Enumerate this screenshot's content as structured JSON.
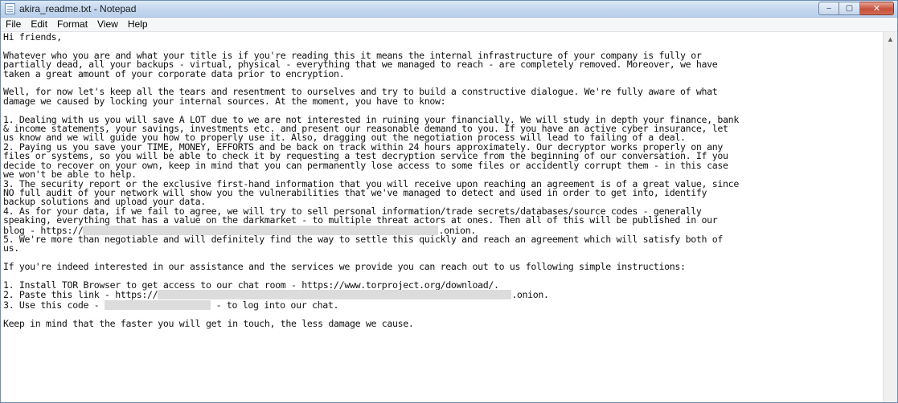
{
  "window": {
    "title": "akira_readme.txt - Notepad",
    "controls": {
      "minimize": "‒",
      "maximize": "▢",
      "close": "✕"
    }
  },
  "menu": [
    "File",
    "Edit",
    "Format",
    "View",
    "Help"
  ],
  "document": {
    "greeting": "Hi friends,",
    "p1": "Whatever who you are and what your title is if you're reading this it means the internal infrastructure of your company is fully or\npartially dead, all your backups - virtual, physical - everything that we managed to reach - are completely removed. Moreover, we have\ntaken a great amount of your corporate data prior to encryption.",
    "p2": "Well, for now let's keep all the tears and resentment to ourselves and try to build a constructive dialogue. We're fully aware of what\ndamage we caused by locking your internal sources. At the moment, you have to know:",
    "item1": "1. Dealing with us you will save A LOT due to we are not interested in ruining your financially. We will study in depth your finance, bank\n& income statements, your savings, investments etc. and present our reasonable demand to you. If you have an active cyber insurance, let\nus know and we will guide you how to properly use it. Also, dragging out the negotiation process will lead to failing of a deal.",
    "item2": "2. Paying us you save your TIME, MONEY, EFFORTS and be back on track within 24 hours approximately. Our decryptor works properly on any\nfiles or systems, so you will be able to check it by requesting a test decryption service from the beginning of our conversation. If you\ndecide to recover on your own, keep in mind that you can permanently lose access to some files or accidently corrupt them - in this case\nwe won't be able to help.",
    "item3": "3. The security report or the exclusive first-hand information that you will receive upon reaching an agreement is of a great value, since\nNO full audit of your network will show you the vulnerabilities that we've managed to detect and used in order to get into, identify\nbackup solutions and upload your data.",
    "item4_a": "4. As for your data, if we fail to agree, we will try to sell personal information/trade secrets/databases/source codes - generally\nspeaking, everything that has a value on the darkmarket - to multiple threat actors at ones. Then all of this will be published in our\nblog - https://",
    "item4_b": ".onion.",
    "item5": "5. We're more than negotiable and will definitely find the way to settle this quickly and reach an agreement which will satisfy both of\nus.",
    "p3": "If you're indeed interested in our assistance and the services we provide you can reach out to us following simple instructions:",
    "step1": "1. Install TOR Browser to get access to our chat room - https://www.torproject.org/download/.",
    "step2_a": "2. Paste this link - https://",
    "step2_b": ".onion.",
    "step3_a": "3. Use this code - ",
    "step3_b": " - to log into our chat.",
    "closing": "Keep in mind that the faster you will get in touch, the less damage we cause."
  },
  "colors": {
    "redaction": "#dcdcdc",
    "titlebar": "#c3d7ef",
    "close_button": "#c7503a"
  }
}
